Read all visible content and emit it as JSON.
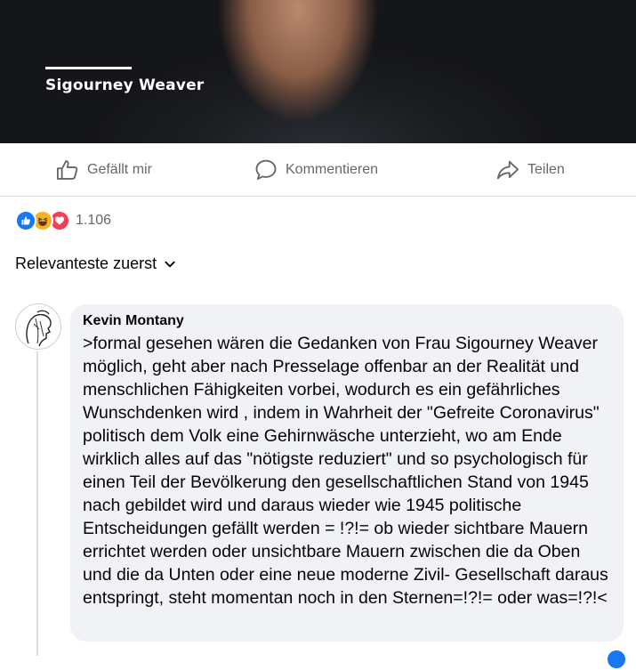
{
  "post_image": {
    "caption": "Sigourney Weaver"
  },
  "actions": {
    "like_label": "Gefällt mir",
    "comment_label": "Kommentieren",
    "share_label": "Teilen"
  },
  "reactions": {
    "icons": [
      "like-icon",
      "haha-icon",
      "love-icon"
    ],
    "count": "1.106"
  },
  "comments_sort": {
    "label": "Relevanteste zuerst"
  },
  "comment": {
    "author": "Kevin Montany",
    "text": ">formal gesehen wären die Gedanken von Frau Sigourney Weaver möglich, geht aber nach Presselage offenbar an der Realität und menschlichen Fähigkeiten vorbei, wodurch es ein gefährliches Wunschdenken wird , indem in Wahrheit der \"Gefreite Coronavirus\" politisch dem Volk eine Gehirnwäsche unterzieht, wo am Ende wirklich alles auf das \"nötigste reduziert\" und so psychologisch für einen Teil der Bevölkerung den gesellschaftlichen Stand von 1945 nach gebildet wird und daraus wieder wie 1945 politische Entscheidungen gefällt werden = !?!= ob wieder sichtbare Mauern errichtet werden oder unsichtbare Mauern zwischen die da Oben und die da Unten oder eine neue moderne Zivil- Gesellschaft daraus entspringt, steht momentan noch in den Sternen=!?!= oder was=!?!<"
  },
  "colors": {
    "accent": "#1877f2",
    "secondary_text": "#65676b",
    "bubble_bg": "#f0f2f5"
  }
}
